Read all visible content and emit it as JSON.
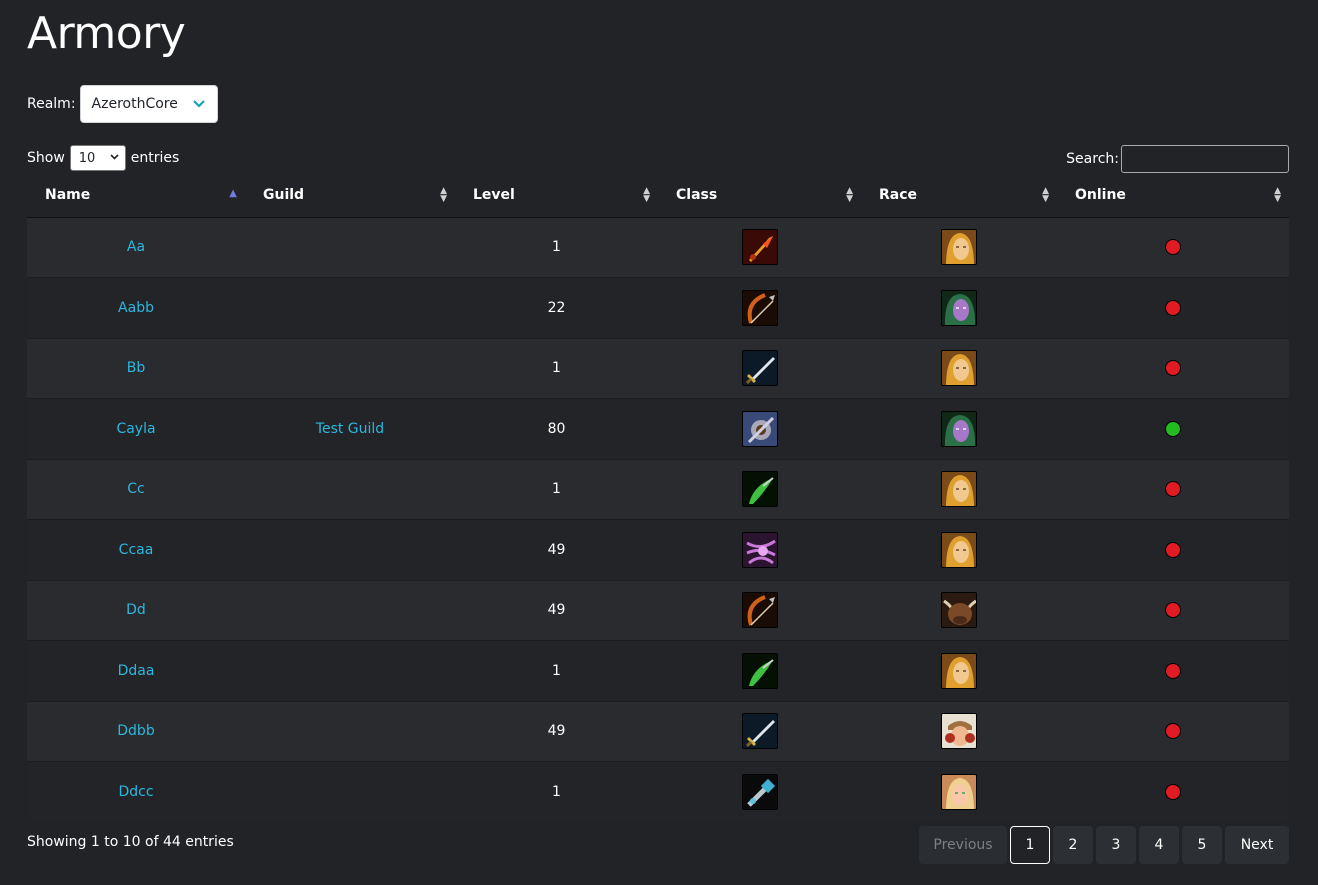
{
  "title": "Armory",
  "realm": {
    "label": "Realm:",
    "selected": "AzerothCore"
  },
  "length": {
    "prefix": "Show",
    "value": "10",
    "suffix": "entries"
  },
  "search": {
    "label": "Search:",
    "value": ""
  },
  "columns": [
    "Name",
    "Guild",
    "Level",
    "Class",
    "Race",
    "Online"
  ],
  "rows": [
    {
      "name": "Aa",
      "guild": "",
      "level": "1",
      "class_icon": "rogue-icon",
      "race_icon": "human-female-icon",
      "online": false
    },
    {
      "name": "Aabb",
      "guild": "",
      "level": "22",
      "class_icon": "hunter-icon",
      "race_icon": "night-elf-female-icon",
      "online": false
    },
    {
      "name": "Bb",
      "guild": "",
      "level": "1",
      "class_icon": "warrior-icon",
      "race_icon": "human-female-icon",
      "online": false
    },
    {
      "name": "Cayla",
      "guild": "Test Guild",
      "level": "80",
      "class_icon": "paladin-icon",
      "race_icon": "night-elf-female-icon",
      "online": true
    },
    {
      "name": "Cc",
      "guild": "",
      "level": "1",
      "class_icon": "druid-icon",
      "race_icon": "human-female-icon",
      "online": false
    },
    {
      "name": "Ccaa",
      "guild": "",
      "level": "49",
      "class_icon": "warlock-icon",
      "race_icon": "human-female-icon",
      "online": false
    },
    {
      "name": "Dd",
      "guild": "",
      "level": "49",
      "class_icon": "hunter-icon",
      "race_icon": "tauren-icon",
      "online": false
    },
    {
      "name": "Ddaa",
      "guild": "",
      "level": "1",
      "class_icon": "druid-icon",
      "race_icon": "human-female-icon",
      "online": false
    },
    {
      "name": "Ddbb",
      "guild": "",
      "level": "49",
      "class_icon": "warrior-icon",
      "race_icon": "dwarf-female-icon",
      "online": false
    },
    {
      "name": "Ddcc",
      "guild": "",
      "level": "1",
      "class_icon": "shaman-icon",
      "race_icon": "blood-elf-female-icon",
      "online": false
    }
  ],
  "footer": {
    "info": "Showing 1 to 10 of 44 entries"
  },
  "pagination": {
    "previous": "Previous",
    "pages": [
      "1",
      "2",
      "3",
      "4",
      "5"
    ],
    "active": "1",
    "next": "Next"
  },
  "colors": {
    "background": "#222327",
    "link": "#2cb7e0",
    "online": "#22bb22",
    "offline": "#e01b24",
    "row_odd": "#2a2b2e",
    "row_even": "#232427"
  }
}
